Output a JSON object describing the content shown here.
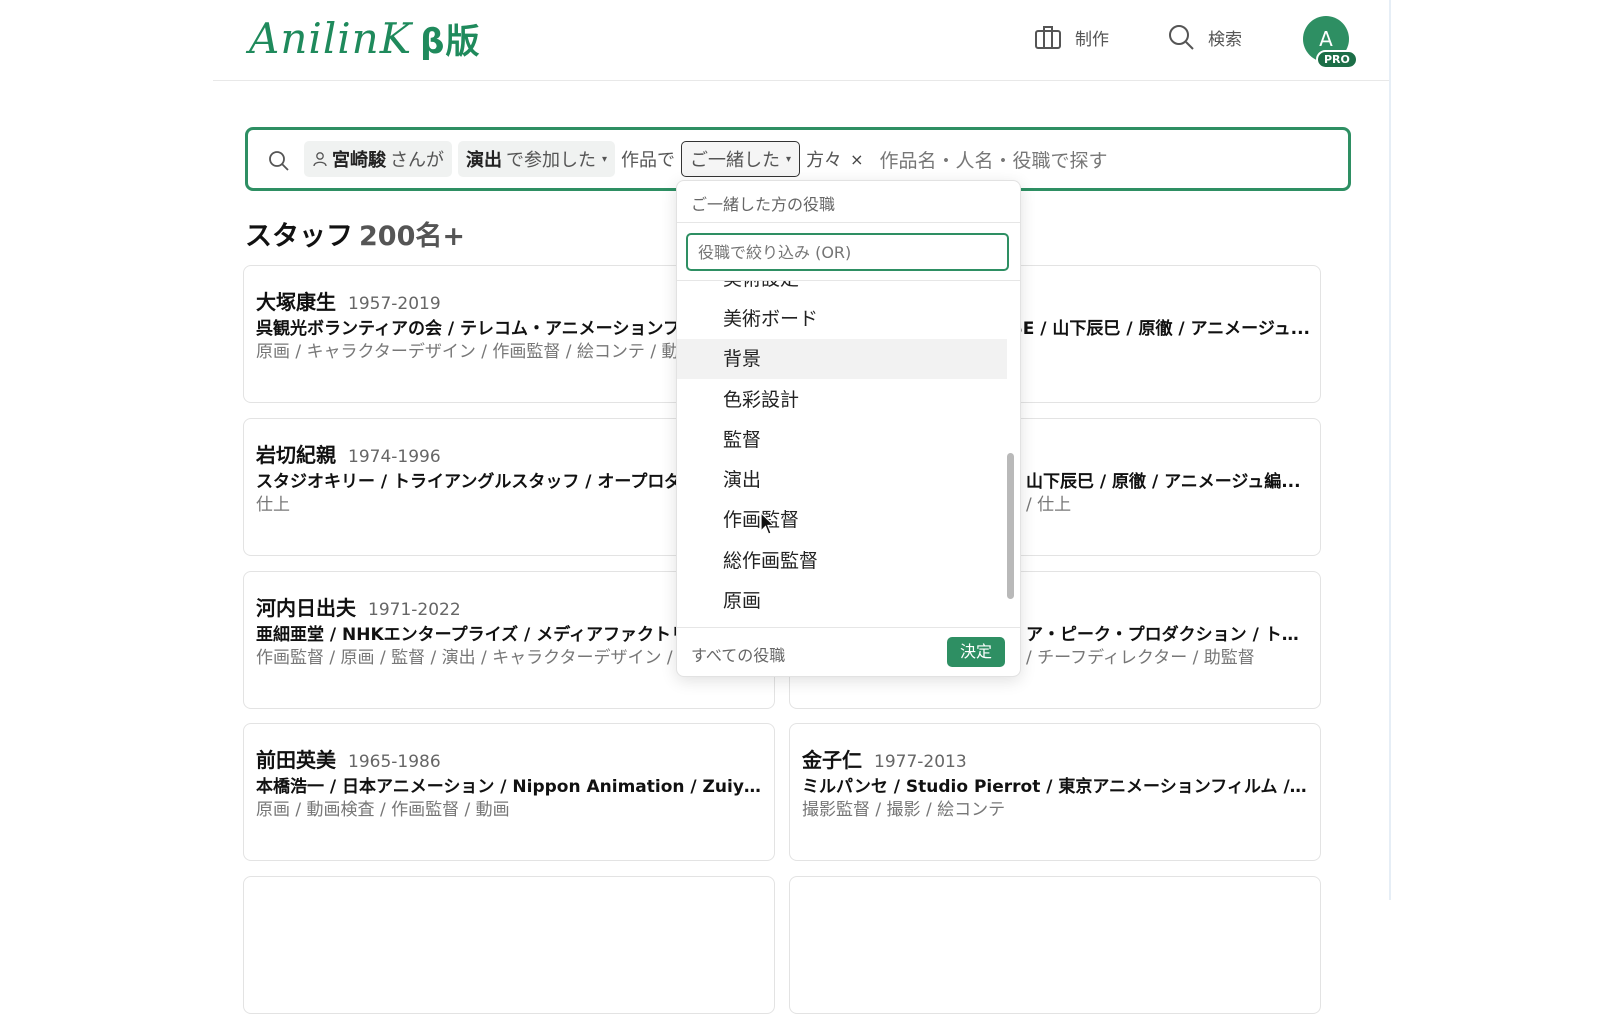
{
  "header": {
    "logo": "AnilinK",
    "logo_beta": "β版",
    "nav": [
      {
        "label": "制作",
        "icon": "briefcase-icon"
      },
      {
        "label": "検索",
        "icon": "search-icon"
      }
    ],
    "avatar_letter": "A",
    "avatar_badge": "PRO"
  },
  "search": {
    "person": "宮崎駿",
    "person_suffix": "さんが",
    "role": "演出",
    "role_suffix": "で参加した",
    "works_text": "作品で",
    "together": "ご一緒した",
    "people_text": "方々",
    "close": "×",
    "placeholder": "作品名・人名・役職で探す"
  },
  "staff": {
    "title": "スタッフ",
    "count": "200名+"
  },
  "cards": [
    {
      "name": "大塚康生",
      "years": "1957-2019",
      "studios": "呉観光ボランティアの会 / テレコム・アニメーションフィルム / 日本アニメーション",
      "roles": "原画 / キャラクターデザイン / 作画監督 / 絵コンテ / 動画"
    },
    {
      "name": "",
      "years": "",
      "studios": "SE / 山下辰巳 / 原徹 / アニメージュ...",
      "roles": ""
    },
    {
      "name": "岩切紀親",
      "years": "1974-1996",
      "studios": "スタジオキリー / トライアングルスタッフ / オープロダクション",
      "roles": "仕上"
    },
    {
      "name": "",
      "years": "",
      "studios": "山下辰巳 / 原徹 / アニメージュ編...",
      "roles": "/ 仕上"
    },
    {
      "name": "河内日出夫",
      "years": "1971-2022",
      "studios": "亜細亜堂 / NHKエンタープライズ / メディアファクトリー",
      "roles": "作画監督 / 原画 / 監督 / 演出 / キャラクターデザイン / 絵コンテ"
    },
    {
      "name": "",
      "years": "",
      "studios": "ア・ピーク・プロダクション / トム...",
      "roles": "/ チーフディレクター / 助監督"
    },
    {
      "name": "前田英美",
      "years": "1965-1986",
      "studios": "本橋浩一 / 日本アニメーション / Nippon Animation / Zuiyou Ei...",
      "roles": "原画 / 動画検査 / 作画監督 / 動画"
    },
    {
      "name": "金子仁",
      "years": "1977-2013",
      "studios": "ミルパンセ / Studio Pierrot / 東京アニメーションフィルム / 亜...",
      "roles": "撮影監督 / 撮影 / 絵コンテ"
    }
  ],
  "dropdown": {
    "header": "ご一緒した方の役職",
    "filter_placeholder": "役職で絞り込み (OR)",
    "items": [
      "美術設定",
      "美術ボード",
      "背景",
      "色彩設計",
      "監督",
      "演出",
      "作画監督",
      "総作画監督",
      "原画"
    ],
    "hovered_item": "背景",
    "footer_text": "すべての役職",
    "ok_label": "決定"
  },
  "colors": {
    "accent": "#2e8f63",
    "logo": "#1f8a5c"
  }
}
